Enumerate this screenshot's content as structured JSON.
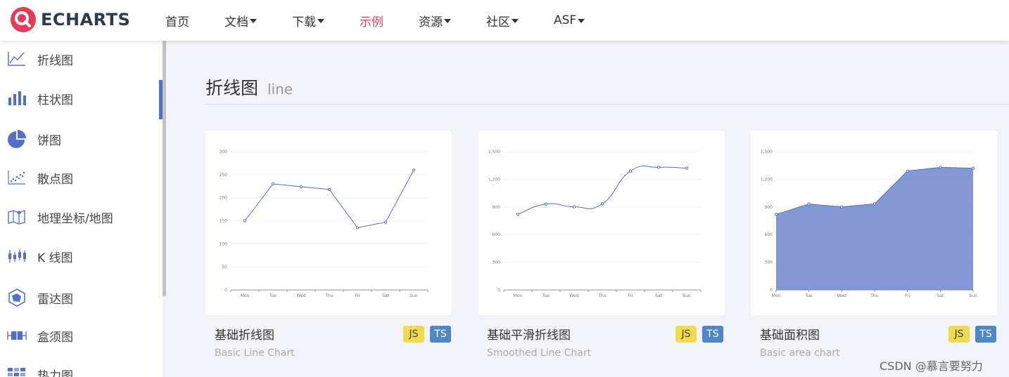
{
  "brand": {
    "name": "ECHARTS",
    "primary_color": "#e43c59",
    "text_color": "#2b3c4e"
  },
  "nav": {
    "items": [
      {
        "label": "首页",
        "dropdown": false,
        "active": false
      },
      {
        "label": "文档",
        "dropdown": true,
        "active": false
      },
      {
        "label": "下载",
        "dropdown": true,
        "active": false
      },
      {
        "label": "示例",
        "dropdown": false,
        "active": true
      },
      {
        "label": "资源",
        "dropdown": true,
        "active": false
      },
      {
        "label": "社区",
        "dropdown": true,
        "active": false
      },
      {
        "label": "ASF",
        "dropdown": true,
        "active": false
      }
    ]
  },
  "sidebar": {
    "active_index": 1,
    "items": [
      {
        "label": "折线图",
        "icon": "line-chart-icon"
      },
      {
        "label": "柱状图",
        "icon": "bar-chart-icon"
      },
      {
        "label": "饼图",
        "icon": "pie-chart-icon"
      },
      {
        "label": "散点图",
        "icon": "scatter-chart-icon"
      },
      {
        "label": "地理坐标/地图",
        "icon": "map-icon"
      },
      {
        "label": "K 线图",
        "icon": "candlestick-icon"
      },
      {
        "label": "雷达图",
        "icon": "radar-icon"
      },
      {
        "label": "盒须图",
        "icon": "boxplot-icon"
      },
      {
        "label": "热力图",
        "icon": "heatmap-icon"
      }
    ]
  },
  "section": {
    "title": "折线图",
    "subtitle": "line"
  },
  "cards": [
    {
      "title": "基础折线图",
      "subtitle": "Basic Line Chart",
      "badges": [
        "JS",
        "TS"
      ]
    },
    {
      "title": "基础平滑折线图",
      "subtitle": "Smoothed Line Chart",
      "badges": [
        "JS",
        "TS"
      ]
    },
    {
      "title": "基础面积图",
      "subtitle": "Basic area chart",
      "badges": [
        "JS",
        "TS"
      ]
    }
  ],
  "chart_data": [
    {
      "type": "line",
      "categories": [
        "Mon",
        "Tue",
        "Wed",
        "Thu",
        "Fri",
        "Sat",
        "Sun"
      ],
      "values": [
        150,
        230,
        224,
        218,
        135,
        147,
        260
      ],
      "ylim": [
        0,
        300
      ],
      "yticks": [
        "0",
        "50",
        "100",
        "150",
        "200",
        "250",
        "300"
      ],
      "smooth": false,
      "area": false,
      "color": "#5470c6",
      "grid": true
    },
    {
      "type": "line",
      "categories": [
        "Mon",
        "Tue",
        "Wed",
        "Thu",
        "Fri",
        "Sat",
        "Sun"
      ],
      "values": [
        820,
        932,
        901,
        934,
        1290,
        1330,
        1320
      ],
      "ylim": [
        0,
        1500
      ],
      "yticks": [
        "0",
        "300",
        "600",
        "900",
        "1,200",
        "1,500"
      ],
      "smooth": true,
      "area": false,
      "color": "#5470c6",
      "grid": true
    },
    {
      "type": "area",
      "categories": [
        "Mon",
        "Tue",
        "Wed",
        "Thu",
        "Fri",
        "Sat",
        "Sun"
      ],
      "values": [
        820,
        932,
        901,
        934,
        1290,
        1330,
        1320
      ],
      "ylim": [
        0,
        1500
      ],
      "yticks": [
        "0",
        "300",
        "600",
        "900",
        "1,200",
        "1,500"
      ],
      "smooth": false,
      "area": true,
      "color": "#5470c6",
      "grid": true
    }
  ],
  "watermark": "CSDN @慕言要努力"
}
